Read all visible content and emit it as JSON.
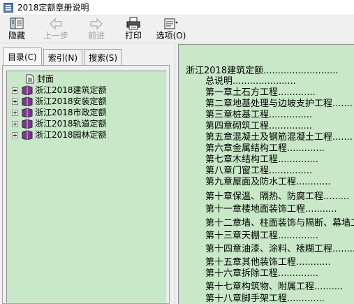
{
  "window": {
    "title": "2018定额章册说明"
  },
  "toolbar": {
    "hide": "隐藏",
    "back": "上一步",
    "forward": "前进",
    "print": "打印",
    "options": "选项(O)"
  },
  "tabs": {
    "contents": "目录(C)",
    "index": "索引(N)",
    "search": "搜索(S)"
  },
  "tree": {
    "cover": "封面",
    "books": [
      "浙江2018建筑定额",
      "浙江2018安装定额",
      "浙江2018市政定额",
      "浙江2018轨道定额",
      "浙江2018园林定额"
    ]
  },
  "content": {
    "heading": "浙江2018建筑定额..........................",
    "lines": [
      "总说明......................",
      "第一章土石方工程.............",
      "第二章地基处理与边坡支护工程.......",
      "第三章桩基工程...............",
      "第四章砌筑工程...............",
      "第五章混凝土及钢筋混凝土工程.......",
      "第六章金属结构工程.............",
      "第七章木结构工程..............",
      "第八章门窗工程...............",
      "第九章屋面及防水工程............",
      "第十章保温、隔热、防腐工程.........",
      "第十一章楼地面装饰工程...........",
      "第十二章墙、柱面装饰与隔断、幕墙工程",
      "第十三章天棚工程..............",
      "第十四章油漆、涂料、裱糊工程........",
      "第十五章其他装饰工程............",
      "第十六章拆除工程..............",
      "第十七章构筑物、附属工程..........",
      "第十八章脚手架工程............."
    ]
  },
  "colors": {
    "panel_bg": "#c8e8c8",
    "chrome": "#f0f0f0",
    "book_purple": "#7a3a8c"
  }
}
